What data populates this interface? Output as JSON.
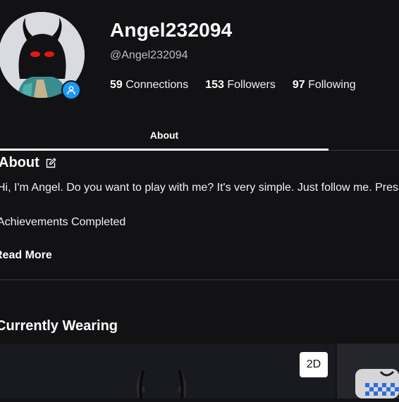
{
  "profile": {
    "display_name": "Angel232094",
    "handle": "@Angel232094",
    "stats": [
      {
        "count": "59",
        "label": "Connections"
      },
      {
        "count": "153",
        "label": "Followers"
      },
      {
        "count": "97",
        "label": "Following"
      }
    ]
  },
  "tabs": {
    "about_label": "About"
  },
  "about": {
    "title": "About",
    "bio": "Hi, I'm Angel. Do you want to play with me? It's very simple. Just follow me. Press",
    "achievements": "Achievements Completed",
    "read_more": "Read More"
  },
  "wearing": {
    "title": "Currently Wearing",
    "view_toggle": "2D"
  },
  "colors": {
    "background": "#121215",
    "presence_badge": "#1e98f5",
    "divider": "#393b3d"
  },
  "icons": {
    "edit": "edit-icon",
    "presence": "user-icon"
  }
}
